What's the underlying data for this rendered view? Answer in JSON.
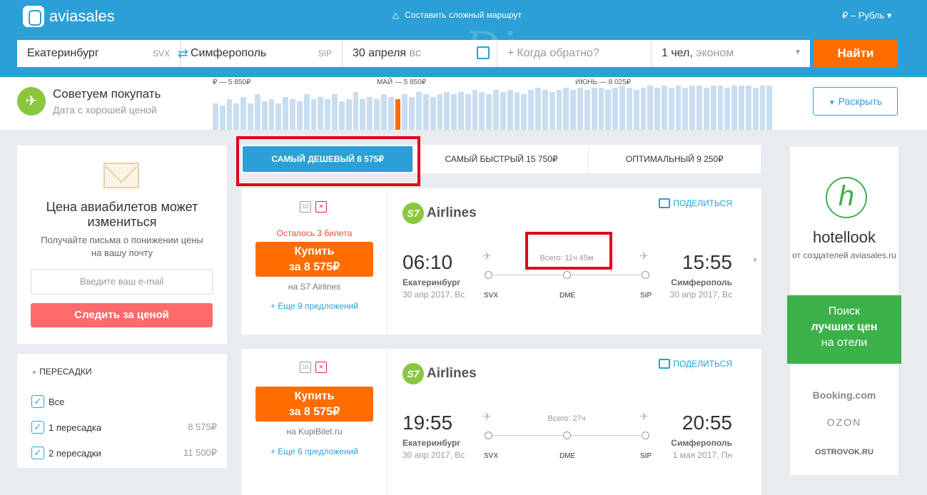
{
  "header": {
    "logo": "aviasales",
    "complex_route": "Составить сложный маршрут",
    "currency": "₽ – Рубль ▾",
    "watermark": "Discover"
  },
  "search": {
    "from": "Екатеринбург",
    "from_code": "SVX",
    "to": "Симферополь",
    "to_code": "SIP",
    "depart_date": "30 апреля",
    "depart_day": "вс",
    "return_placeholder": "Когда обратно?",
    "passengers": "1 чел,",
    "class": "эконом",
    "find": "Найти"
  },
  "advice": {
    "title": "Советуем покупать",
    "subtitle": "Дата с хорошей ценой",
    "months": [
      "₽ — 5 850₽",
      "МАЙ — 5 850₽",
      "ИЮНЬ — 8 025₽"
    ],
    "expand": "Раскрыть",
    "bars": [
      0.6,
      0.55,
      0.7,
      0.6,
      0.75,
      0.6,
      0.8,
      0.65,
      0.7,
      0.6,
      0.75,
      0.7,
      0.65,
      0.8,
      0.7,
      0.75,
      0.7,
      0.8,
      0.65,
      0.7,
      0.85,
      0.7,
      0.75,
      0.7,
      0.8,
      0.75,
      0.7,
      0.8,
      0.75,
      0.85,
      0.8,
      0.75,
      0.8,
      0.85,
      0.8,
      0.85,
      0.8,
      0.9,
      0.85,
      0.8,
      0.9,
      0.85,
      0.9,
      0.85,
      0.8,
      0.9,
      0.95,
      0.9,
      0.85,
      0.9,
      0.95,
      0.9,
      0.95,
      0.9,
      0.95,
      0.95,
      0.9,
      0.95,
      1.0,
      0.95,
      0.9,
      0.95,
      1.0,
      0.95,
      1.0,
      0.95,
      1.0,
      0.95,
      1.0,
      1.0,
      0.95,
      1.0,
      1.0,
      0.95,
      1.0,
      1.0,
      1.0,
      0.95,
      1.0,
      1.0
    ],
    "selected_index": 26
  },
  "subscribe": {
    "title": "Цена авиабилетов может измениться",
    "subtitle": "Получайте письма о понижении цены на вашу почту",
    "email_placeholder": "Введите ваш e-mail",
    "button": "Следить за ценой"
  },
  "filters": {
    "title": "ПЕРЕСАДКИ",
    "items": [
      {
        "label": "Все",
        "price": ""
      },
      {
        "label": "1 пересадка",
        "price": "8 575₽"
      },
      {
        "label": "2 пересадки",
        "price": "11 500₽"
      }
    ]
  },
  "tabs": [
    {
      "label": "САМЫЙ ДЕШЕВЫЙ 8 575₽"
    },
    {
      "label": "САМЫЙ БЫСТРЫЙ 15 750₽"
    },
    {
      "label": "ОПТИМАЛЬНЫЙ 9 250₽"
    }
  ],
  "tickets": [
    {
      "bag": "10",
      "remaining": "Осталось 3 билета",
      "buy": "Купить",
      "price": "за 8 575₽",
      "seller": "на S7 Airlines",
      "more": "+ Еще 9 предложений",
      "airline": "Airlines",
      "airline_mark": "S7",
      "share": "ПОДЕЛИТЬСЯ",
      "dep_time": "06:10",
      "arr_time": "15:55",
      "dep_city": "Екатеринбург",
      "dep_date": "30 апр 2017, Вс",
      "arr_city": "Симферополь",
      "arr_date": "30 апр 2017, Вс",
      "total": "Всего: 11ч 45м",
      "codes": [
        "SVX",
        "DME",
        "SIP"
      ]
    },
    {
      "bag": "10",
      "remaining": "",
      "buy": "Купить",
      "price": "за 8 575₽",
      "seller": "на KupiBilet.ru",
      "more": "+ Еще 6 предложений",
      "airline": "Airlines",
      "airline_mark": "S7",
      "share": "ПОДЕЛИТЬСЯ",
      "dep_time": "19:55",
      "arr_time": "20:55",
      "dep_city": "Екатеринбург",
      "dep_date": "30 апр 2017, Вс",
      "arr_city": "Симферополь",
      "arr_date": "1 мая 2017, Пн",
      "total": "Всего: 27ч",
      "codes": [
        "SVX",
        "DME",
        "SIP"
      ]
    }
  ],
  "ad": {
    "logo_letter": "h",
    "name": "hotellook",
    "sub": "от создателей aviasales.ru",
    "green": [
      "Поиск",
      "лучших цен",
      "на отели"
    ],
    "partners": [
      "Booking.com",
      "OZON",
      "OSTROVOK.RU"
    ]
  },
  "colors": {
    "primary": "#2aa0d6",
    "orange": "#ff6d00",
    "green": "#8bc63f",
    "highlight": "#e0001a"
  }
}
